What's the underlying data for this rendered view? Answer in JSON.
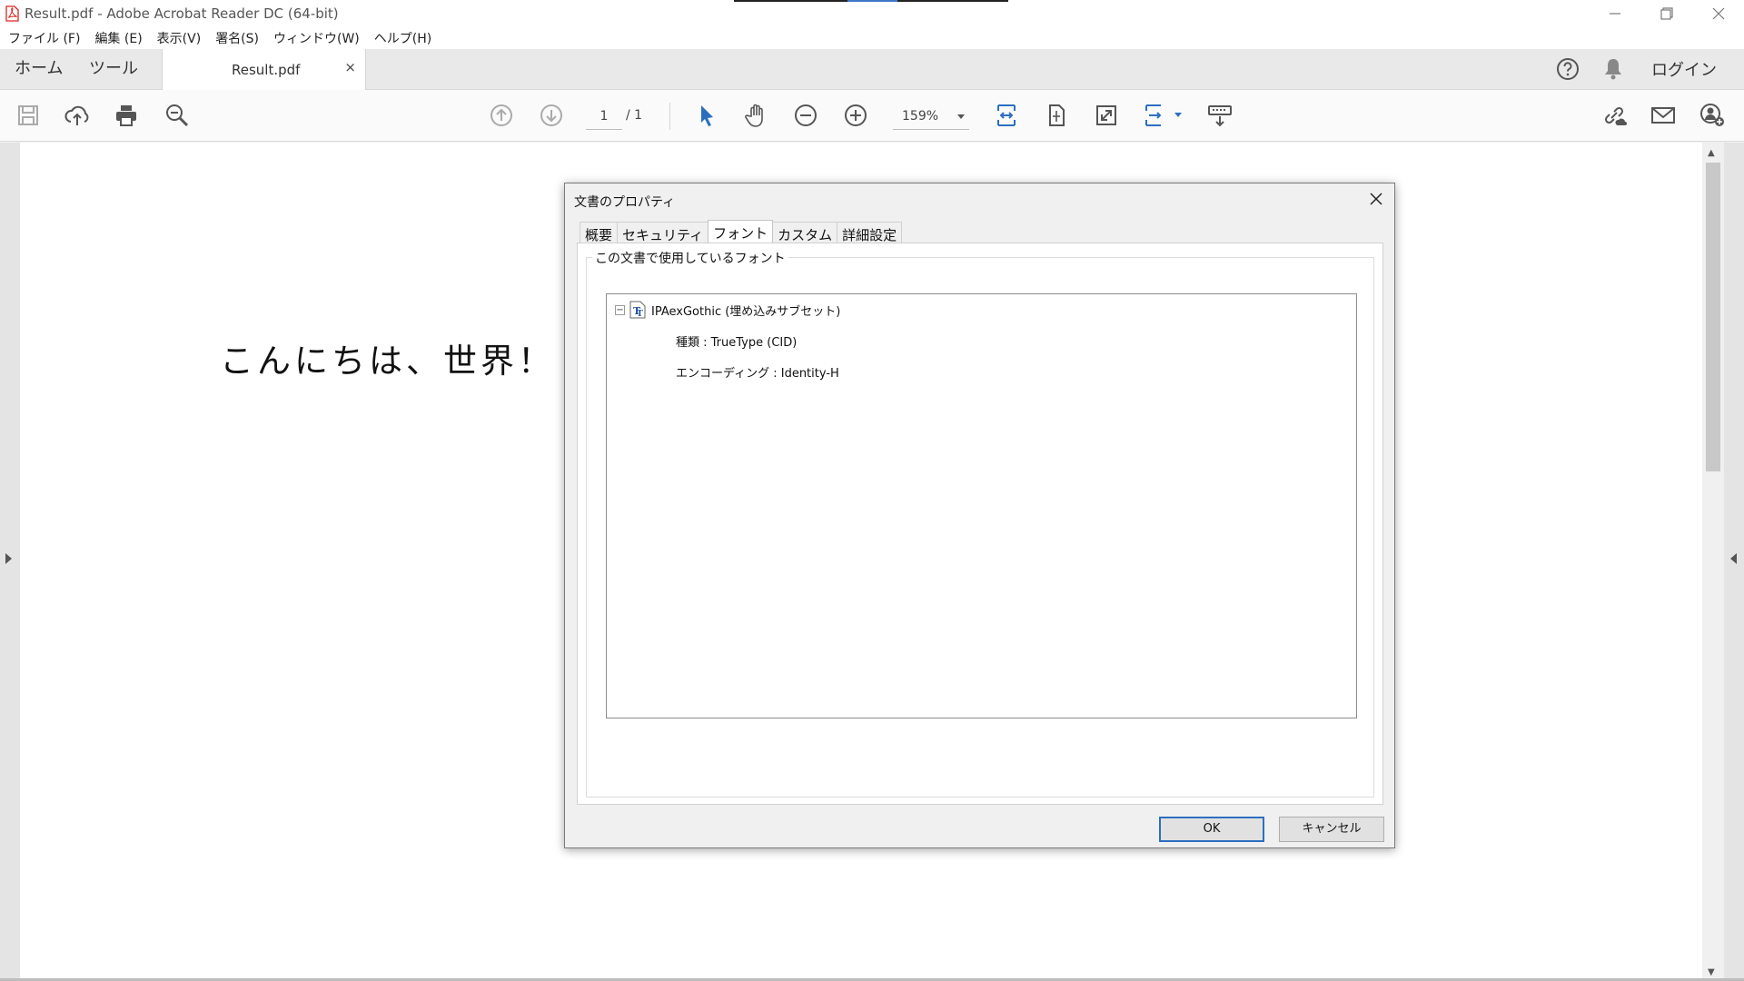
{
  "window": {
    "title": "Result.pdf - Adobe Acrobat Reader DC (64-bit)"
  },
  "menu": [
    "ファイル (F)",
    "編集 (E)",
    "表示(V)",
    "署名(S)",
    "ウィンドウ(W)",
    "ヘルプ(H)"
  ],
  "tabs": {
    "home": "ホーム",
    "tools": "ツール",
    "document": "Result.pdf",
    "close": "×",
    "login": "ログイン"
  },
  "toolbar": {
    "page_current": "1",
    "page_total": "/ 1",
    "zoom": "159%"
  },
  "document": {
    "text": "こんにちは、世界！"
  },
  "dialog": {
    "title": "文書のプロパティ",
    "tabs": [
      "概要",
      "セキュリティ",
      "フォント",
      "カスタム",
      "詳細設定"
    ],
    "active_tab": "フォント",
    "group_label": "この文書で使用しているフォント",
    "font": {
      "name": "IPAexGothic (埋め込みサブセット)",
      "type": "種類 : TrueType (CID)",
      "encoding": "エンコーディング : Identity-H"
    },
    "ok": "OK",
    "cancel": "キャンセル"
  },
  "colors": {
    "accent": "#2c6fc0",
    "pdf_red": "#d9261c"
  }
}
